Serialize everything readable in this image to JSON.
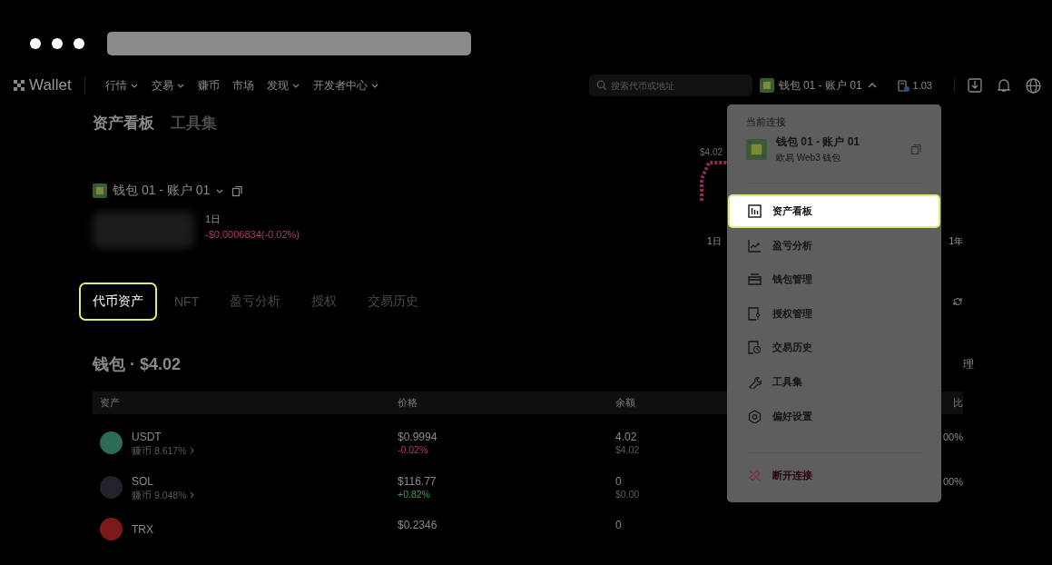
{
  "nav": {
    "logo": "Wallet",
    "items": [
      {
        "label": "行情",
        "dropdown": true
      },
      {
        "label": "交易",
        "dropdown": true
      },
      {
        "label": "赚币",
        "dropdown": false
      },
      {
        "label": "市场",
        "dropdown": false
      },
      {
        "label": "发现",
        "dropdown": true
      },
      {
        "label": "开发者中心",
        "dropdown": true
      }
    ],
    "search": {
      "placeholder": "搜索代币或地址"
    },
    "account": {
      "label": "钱包 01 - 账户 01",
      "expanded": true
    },
    "gas": "1.03"
  },
  "overview": {
    "tabs": [
      {
        "label": "资产看板",
        "selected": true
      },
      {
        "label": "工具集",
        "selected": false
      }
    ],
    "account": "钱包 01 - 账户 01",
    "period": "1日",
    "change": "-$0.0006834(-0.02%)",
    "chart": {
      "top_label": "$4.02",
      "ranges": [
        "1日",
        "1年"
      ]
    }
  },
  "asset_tabs": [
    {
      "label": "代币资产",
      "selected": true
    },
    {
      "label": "NFT",
      "selected": false
    },
    {
      "label": "盈亏分析",
      "selected": false
    },
    {
      "label": "授权",
      "selected": false
    },
    {
      "label": "交易历史",
      "selected": false
    }
  ],
  "wallet_heading": "钱包 · $4.02",
  "right_partial": "理",
  "table": {
    "columns": [
      "资产",
      "价格",
      "余额",
      "比"
    ],
    "rows": [
      {
        "symbol": "USDT",
        "earn": "赚币 8.617%",
        "price": "$0.9994",
        "change": "-0.02%",
        "kind": "down",
        "balance": "4.02",
        "value": "$4.02",
        "share": "00%",
        "color": "#2e6b57"
      },
      {
        "symbol": "SOL",
        "earn": "赚币 9.048%",
        "price": "$116.77",
        "change": "+0.82%",
        "kind": "up",
        "balance": "0",
        "value": "$0.00",
        "share": "00%",
        "color": "#22222a"
      },
      {
        "symbol": "TRX",
        "price": "$0.2346",
        "balance": "0",
        "color": "#7a1a1a"
      }
    ]
  },
  "menu": {
    "header": "当前连接",
    "account": "钱包 01 - 账户 01",
    "wallet_type": "欧易 Web3 钱包",
    "items": [
      {
        "label": "资产看板",
        "selected": true,
        "kind": "normal"
      },
      {
        "label": "盈亏分析",
        "selected": false,
        "kind": "normal"
      },
      {
        "label": "钱包管理",
        "selected": false,
        "kind": "normal"
      },
      {
        "label": "授权管理",
        "selected": false,
        "kind": "normal"
      },
      {
        "label": "交易历史",
        "selected": false,
        "kind": "normal"
      },
      {
        "label": "工具集",
        "selected": false,
        "kind": "normal"
      },
      {
        "label": "偏好设置",
        "selected": false,
        "kind": "normal"
      },
      {
        "label": "断开连接",
        "selected": false,
        "kind": "danger"
      }
    ]
  }
}
